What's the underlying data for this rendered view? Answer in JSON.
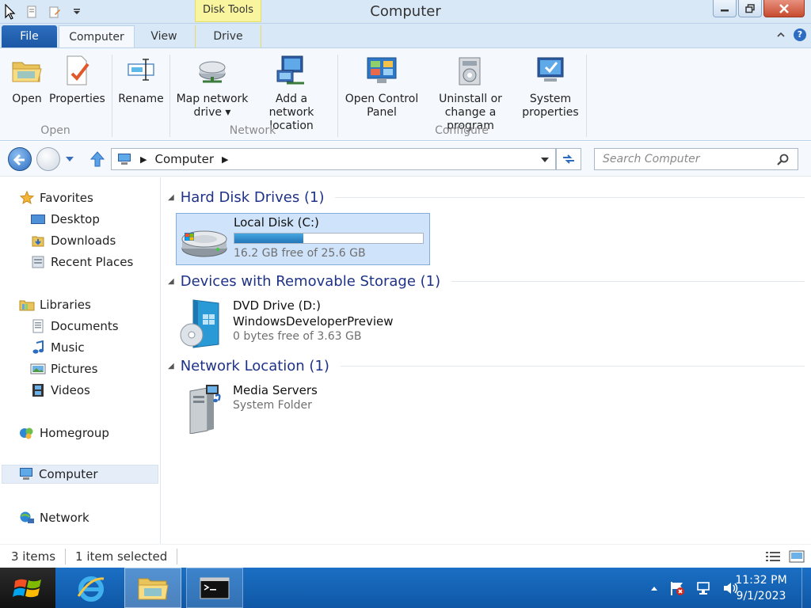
{
  "window": {
    "title": "Computer",
    "contextual_tab_group": "Disk Tools"
  },
  "ribbon": {
    "tabs": [
      {
        "label": "File"
      },
      {
        "label": "Computer"
      },
      {
        "label": "View"
      },
      {
        "label": "Drive"
      }
    ],
    "groups": [
      {
        "label": "Open",
        "buttons": [
          {
            "label": "Open",
            "icon": "folder-open-icon"
          },
          {
            "label": "Properties",
            "icon": "properties-icon"
          }
        ]
      },
      {
        "label": "",
        "buttons": [
          {
            "label": "Rename",
            "icon": "rename-icon"
          }
        ]
      },
      {
        "label": "Network",
        "buttons": [
          {
            "label": "Map network drive ▾",
            "icon": "map-network-drive-icon"
          },
          {
            "label": "Add a network location",
            "icon": "add-network-location-icon"
          }
        ]
      },
      {
        "label": "Configure",
        "buttons": [
          {
            "label": "Open Control Panel",
            "icon": "control-panel-icon"
          },
          {
            "label": "Uninstall or change a program",
            "icon": "uninstall-program-icon"
          },
          {
            "label": "System properties",
            "icon": "system-properties-icon"
          }
        ]
      }
    ]
  },
  "address": {
    "path": "Computer",
    "search_placeholder": "Search Computer"
  },
  "nav_pane": {
    "favorites": {
      "label": "Favorites",
      "items": [
        "Desktop",
        "Downloads",
        "Recent Places"
      ]
    },
    "libraries": {
      "label": "Libraries",
      "items": [
        "Documents",
        "Music",
        "Pictures",
        "Videos"
      ]
    },
    "homegroup": "Homegroup",
    "computer": "Computer",
    "network": "Network"
  },
  "content": {
    "groups": [
      {
        "title": "Hard Disk Drives (1)",
        "items": [
          {
            "name": "Local Disk (C:)",
            "free_text": "16.2 GB free of 25.6 GB",
            "used_fraction": 0.367,
            "selected": true,
            "icon": "hard-disk-icon"
          }
        ]
      },
      {
        "title": "Devices with Removable Storage (1)",
        "items": [
          {
            "name": "DVD Drive (D:)",
            "label": "WindowsDeveloperPreview",
            "free_text": "0 bytes free of 3.63 GB",
            "icon": "dvd-drive-icon"
          }
        ]
      },
      {
        "title": "Network Location (1)",
        "items": [
          {
            "name": "Media Servers",
            "free_text": "System Folder",
            "icon": "media-server-icon"
          }
        ]
      }
    ]
  },
  "status": {
    "items_count": "3 items",
    "selected": "1 item selected"
  },
  "taskbar": {
    "time": "11:32 PM",
    "date": "9/1/2023"
  },
  "colors": {
    "accent": "#1b57a4",
    "group_title": "#1e3287",
    "selection": "#cfe3fa",
    "taskbar": "#1466b8",
    "context_tab": "#f8f59e"
  }
}
